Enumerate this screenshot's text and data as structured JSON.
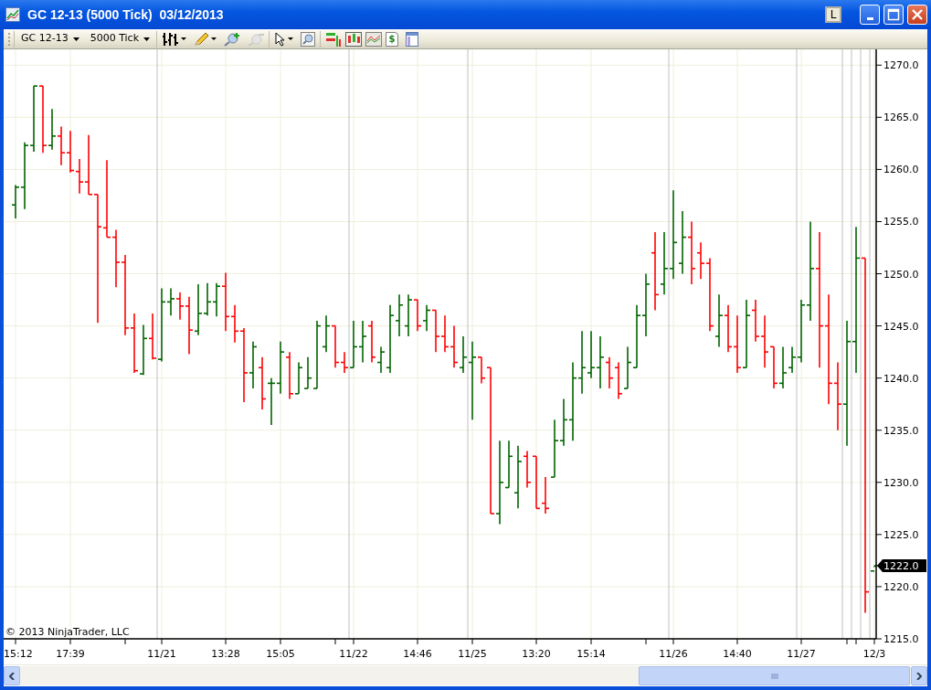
{
  "window": {
    "title": "GC 12-13 (5000 Tick)  03/12/2013",
    "link_button": "L"
  },
  "toolbar": {
    "instrument": "GC 12-13",
    "interval": "5000 Tick",
    "currency_sign": "$"
  },
  "chart": {
    "copyright": "© 2013 NinjaTrader, LLC",
    "price_labels": [
      "1270.0",
      "1265.0",
      "1260.0",
      "1255.0",
      "1250.0",
      "1245.0",
      "1240.0",
      "1235.0",
      "1230.0",
      "1225.0",
      "1220.0",
      "1215.0"
    ],
    "time_labels": [
      "15:12",
      "17:39",
      "11/21",
      "13:28",
      "15:05",
      "11/22",
      "14:46",
      "11/25",
      "13:20",
      "15:14",
      "11/26",
      "14:40",
      "11/27",
      "12/3"
    ],
    "last_price": "1222.0"
  }
}
